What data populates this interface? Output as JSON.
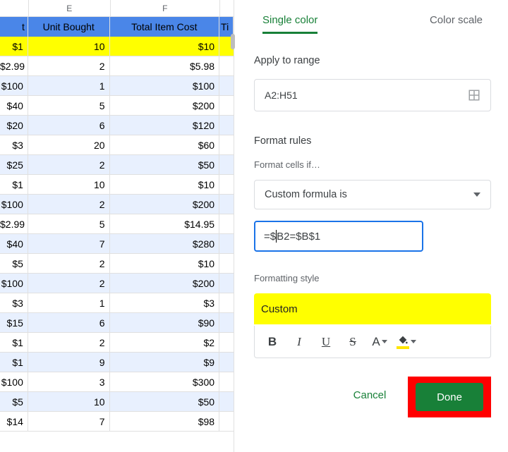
{
  "sheet": {
    "column_letters": {
      "D": "",
      "E": "E",
      "F": "F",
      "G": ""
    },
    "headers": {
      "D": "t",
      "E": "Unit Bought",
      "F": "Total Item Cost",
      "G": "Ti"
    },
    "rows": [
      {
        "D": "$1",
        "E": "10",
        "F": "$10",
        "highlight": true
      },
      {
        "D": "$2.99",
        "E": "2",
        "F": "$5.98"
      },
      {
        "D": "$100",
        "E": "1",
        "F": "$100"
      },
      {
        "D": "$40",
        "E": "5",
        "F": "$200"
      },
      {
        "D": "$20",
        "E": "6",
        "F": "$120"
      },
      {
        "D": "$3",
        "E": "20",
        "F": "$60"
      },
      {
        "D": "$25",
        "E": "2",
        "F": "$50"
      },
      {
        "D": "$1",
        "E": "10",
        "F": "$10"
      },
      {
        "D": "$100",
        "E": "2",
        "F": "$200"
      },
      {
        "D": "$2.99",
        "E": "5",
        "F": "$14.95"
      },
      {
        "D": "$40",
        "E": "7",
        "F": "$280"
      },
      {
        "D": "$5",
        "E": "2",
        "F": "$10"
      },
      {
        "D": "$100",
        "E": "2",
        "F": "$200"
      },
      {
        "D": "$3",
        "E": "1",
        "F": "$3"
      },
      {
        "D": "$15",
        "E": "6",
        "F": "$90"
      },
      {
        "D": "$1",
        "E": "2",
        "F": "$2"
      },
      {
        "D": "$1",
        "E": "9",
        "F": "$9"
      },
      {
        "D": "$100",
        "E": "3",
        "F": "$300"
      },
      {
        "D": "$5",
        "E": "10",
        "F": "$50"
      },
      {
        "D": "$14",
        "E": "7",
        "F": "$98"
      }
    ]
  },
  "panel": {
    "tabs": {
      "single": "Single color",
      "scale": "Color scale"
    },
    "apply_label": "Apply to range",
    "range": "A2:H51",
    "rules_label": "Format rules",
    "cellsif_label": "Format cells if…",
    "rule_type": "Custom formula is",
    "formula_before": "=$",
    "formula_after": "B2=$B$1",
    "style_label": "Formatting style",
    "style_preview": "Custom",
    "toolbar": {
      "bold": "B",
      "italic": "I",
      "uline": "U",
      "strike": "S",
      "textA": "A"
    },
    "actions": {
      "cancel": "Cancel",
      "done": "Done"
    }
  }
}
